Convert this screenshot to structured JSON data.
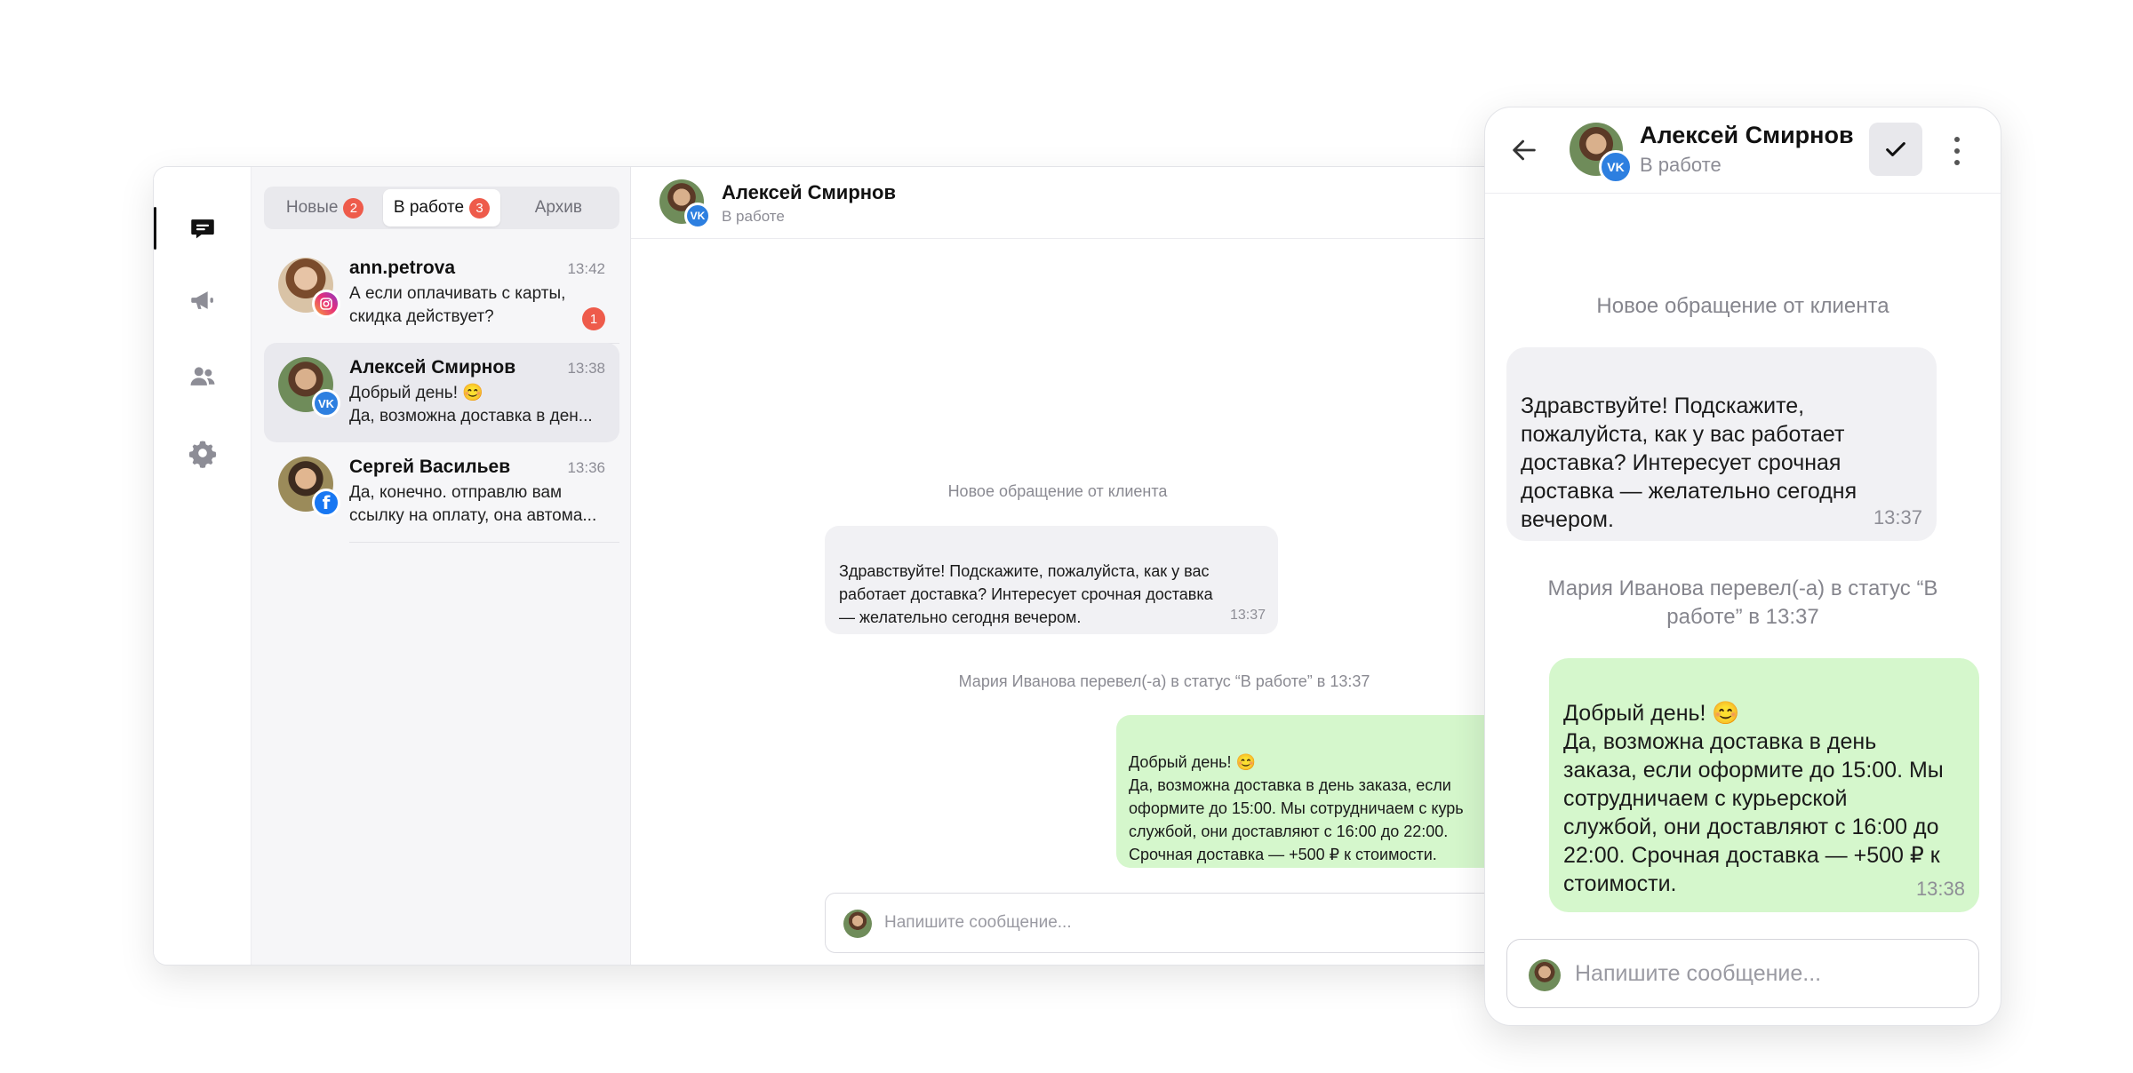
{
  "desktop": {
    "tabs": [
      {
        "label": "Новые",
        "badge": "2"
      },
      {
        "label": "В работе",
        "badge": "3"
      },
      {
        "label": "Архив",
        "badge": ""
      }
    ],
    "conversations": [
      {
        "name": "ann.petrova",
        "time": "13:42",
        "preview": "А если оплачивать с карты,\nскидка действует?",
        "unread": "1",
        "network": "instagram"
      },
      {
        "name": "Алексей Смирнов",
        "time": "13:38",
        "preview": "Добрый день! 😊\nДа, возможна доставка в ден...",
        "unread": "",
        "network": "vk"
      },
      {
        "name": "Сергей Васильев",
        "time": "13:36",
        "preview": "Да, конечно. отправлю вам\nссылку на оплату, она автома...",
        "unread": "",
        "network": "facebook"
      }
    ],
    "chat": {
      "name": "Алексей Смирнов",
      "status": "В работе",
      "system_new": "Новое обращение от клиента",
      "incoming": {
        "text": "Здравствуйте! Подскажите, пожалуйста, как у вас\nработает доставка? Интересует срочная доставка\n— желательно сегодня вечером.",
        "time": "13:37"
      },
      "system_status": "Мария Иванова перевел(-а) в статус “В работе” в 13:37",
      "outgoing": {
        "text": "Добрый день! 😊\nДа, возможна доставка в день заказа, если\nоформите до 15:00. Мы сотрудничаем с курь\nслужбой, они доставляют с 16:00 до 22:00.\nСрочная доставка — +500 ₽ к стоимости."
      },
      "composer_placeholder": "Напишите сообщение..."
    }
  },
  "mobile": {
    "name": "Алексей Смирнов",
    "status": "В работе",
    "system_new": "Новое обращение от клиента",
    "incoming": {
      "text": "Здравствуйте! Подскажите,\nпожалуйста, как у вас работает\nдоставка? Интересует срочная\nдоставка — желательно сегодня\nвечером.",
      "time": "13:37"
    },
    "system_status": "Мария Иванова перевел(-а) в статус “В\nработе” в 13:37",
    "outgoing": {
      "text": "Добрый день! 😊\nДа, возможна доставка в день\nзаказа, если оформите до 15:00. Мы\nсотрудничаем с курьерской\nслужбой, они доставляют с 16:00 до\n22:00. Срочная доставка — +500 ₽ к\nстоимости.",
      "time": "13:38"
    },
    "composer_placeholder": "Напишите сообщение..."
  },
  "colors": {
    "badge": "#ee5b4b",
    "outgoing_bubble": "#d5f7cc",
    "incoming_bubble": "#f1f1f4",
    "vk": "#2d7fe0",
    "facebook": "#1877f2"
  },
  "icons": {
    "rail": [
      "chat-icon",
      "megaphone-icon",
      "users-icon",
      "gear-icon"
    ],
    "mobile": [
      "arrow-left-icon",
      "checkmark-icon",
      "more-vertical-icon"
    ]
  }
}
